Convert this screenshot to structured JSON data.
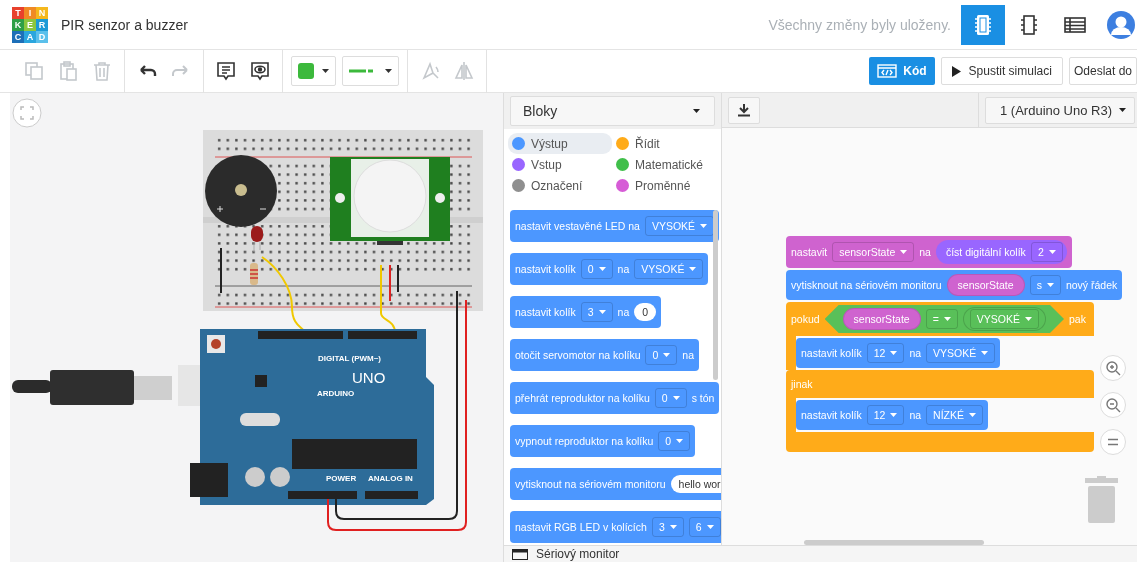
{
  "header": {
    "logo": [
      [
        "T",
        "I",
        "N"
      ],
      [
        "K",
        "E",
        "R"
      ],
      [
        "C",
        "A",
        "D"
      ]
    ],
    "project_title": "PIR senzor a buzzer",
    "save_status": "Všechny změny byly uloženy.",
    "view_buttons": [
      {
        "kind": "circuit",
        "selected": true
      },
      {
        "kind": "schematic",
        "selected": false
      },
      {
        "kind": "components_list",
        "selected": false
      }
    ]
  },
  "toolbar": {
    "groups": [
      [
        {
          "kind": "copy",
          "disabled": true
        },
        {
          "kind": "paste",
          "disabled": true
        },
        {
          "kind": "delete",
          "disabled": true
        }
      ],
      [
        {
          "kind": "undo",
          "disabled": false
        },
        {
          "kind": "redo",
          "disabled": true
        }
      ],
      [
        {
          "kind": "note",
          "disabled": false
        },
        {
          "kind": "notes_visibility",
          "disabled": false
        }
      ],
      [
        {
          "kind": "color_picker",
          "color": "#3cb93c"
        },
        {
          "kind": "wire_style",
          "color": "#3cb93c"
        }
      ],
      [
        {
          "kind": "rotate",
          "disabled": true
        },
        {
          "kind": "mirror",
          "disabled": true
        }
      ]
    ],
    "code_button": {
      "label": "Kód",
      "selected": true
    },
    "simulate_button": {
      "label": "Spustit simulaci"
    },
    "send_button": {
      "label": "Odeslat do"
    }
  },
  "circuit": {
    "board_labels": [
      "DIGITAL (PWM~)",
      "UNO",
      "ARDUINO",
      "POWER",
      "ANALOG IN"
    ]
  },
  "palette": {
    "dropdown": "Bloky",
    "categories": [
      {
        "label": "Výstup",
        "color": "#4c97ff",
        "selected": true
      },
      {
        "label": "Řídit",
        "color": "#ffab19",
        "selected": false
      },
      {
        "label": "Vstup",
        "color": "#9966ff",
        "selected": false
      },
      {
        "label": "Matematické",
        "color": "#40bf4a",
        "selected": false
      },
      {
        "label": "Označení",
        "color": "#8f8f8f",
        "selected": false
      },
      {
        "label": "Proměnné",
        "color": "#d65cd6",
        "selected": false
      }
    ],
    "blocks": [
      {
        "parts": [
          {
            "kind": "text",
            "text": "nastavit vestavěné LED na"
          },
          {
            "kind": "dropdown",
            "text": "VYSOKÉ"
          }
        ]
      },
      {
        "parts": [
          {
            "kind": "text",
            "text": "nastavit kolík"
          },
          {
            "kind": "dropdown",
            "text": "0"
          },
          {
            "kind": "text",
            "text": "na"
          },
          {
            "kind": "dropdown",
            "text": "VYSOKÉ"
          }
        ]
      },
      {
        "parts": [
          {
            "kind": "text",
            "text": "nastavit kolík"
          },
          {
            "kind": "dropdown",
            "text": "3"
          },
          {
            "kind": "text",
            "text": "na"
          },
          {
            "kind": "input",
            "text": "0"
          }
        ]
      },
      {
        "parts": [
          {
            "kind": "text",
            "text": "otočit servomotor na kolíku"
          },
          {
            "kind": "dropdown",
            "text": "0"
          },
          {
            "kind": "text",
            "text": "na"
          }
        ]
      },
      {
        "parts": [
          {
            "kind": "text",
            "text": "přehrát reproduktor na kolíku"
          },
          {
            "kind": "dropdown",
            "text": "0"
          },
          {
            "kind": "text",
            "text": "s tón"
          }
        ]
      },
      {
        "parts": [
          {
            "kind": "text",
            "text": "vypnout reproduktor na kolíku"
          },
          {
            "kind": "dropdown",
            "text": "0"
          }
        ]
      },
      {
        "parts": [
          {
            "kind": "text",
            "text": "vytisknout na sériovém monitoru"
          },
          {
            "kind": "input",
            "text": "hello wor"
          }
        ]
      },
      {
        "parts": [
          {
            "kind": "text",
            "text": "nastavit RGB LED v kolících"
          },
          {
            "kind": "dropdown",
            "text": "3"
          },
          {
            "kind": "dropdown",
            "text": "6"
          }
        ]
      }
    ]
  },
  "code_editor": {
    "device_dropdown": "1 (Arduino Uno R3)",
    "script": [
      {
        "kind": "variable",
        "parts": [
          {
            "kind": "text",
            "text": "nastavit"
          },
          {
            "kind": "dropdown",
            "text": "sensorState"
          },
          {
            "kind": "text",
            "text": "na"
          },
          {
            "kind": "reporter",
            "parts": [
              {
                "kind": "text",
                "text": "číst digitální kolík"
              },
              {
                "kind": "dropdown",
                "text": "2"
              }
            ]
          }
        ]
      },
      {
        "kind": "output",
        "parts": [
          {
            "kind": "text",
            "text": "vytisknout na sériovém monitoru"
          },
          {
            "kind": "variable",
            "text": "sensorState"
          },
          {
            "kind": "dropdown",
            "text": "s"
          },
          {
            "kind": "text",
            "text": "nový řádek"
          }
        ]
      },
      {
        "kind": "control",
        "branches": [
          {
            "parts": [
              {
                "kind": "text",
                "text": "pokud"
              },
              {
                "kind": "condition",
                "parts": [
                  {
                    "kind": "variable",
                    "text": "sensorState"
                  },
                  {
                    "kind": "dropdown",
                    "text": "="
                  },
                  {
                    "kind": "value",
                    "parts": [
                      {
                        "kind": "dropdown",
                        "text": "VYSOKÉ"
                      }
                    ]
                  }
                ]
              },
              {
                "kind": "text",
                "text": "pak"
              }
            ],
            "children": [
              {
                "kind": "output",
                "parts": [
                  {
                    "kind": "text",
                    "text": "nastavit kolík"
                  },
                  {
                    "kind": "dropdown",
                    "text": "12"
                  },
                  {
                    "kind": "text",
                    "text": "na"
                  },
                  {
                    "kind": "dropdown",
                    "text": "VYSOKÉ"
                  }
                ]
              }
            ]
          },
          {
            "parts": [
              {
                "kind": "text",
                "text": "jinak"
              }
            ],
            "children": [
              {
                "kind": "output",
                "parts": [
                  {
                    "kind": "text",
                    "text": "nastavit kolík"
                  },
                  {
                    "kind": "dropdown",
                    "text": "12"
                  },
                  {
                    "kind": "text",
                    "text": "na"
                  },
                  {
                    "kind": "dropdown",
                    "text": "NÍZKÉ"
                  }
                ]
              }
            ]
          }
        ]
      }
    ]
  },
  "serial_monitor": {
    "label": "Sériový monitor"
  }
}
